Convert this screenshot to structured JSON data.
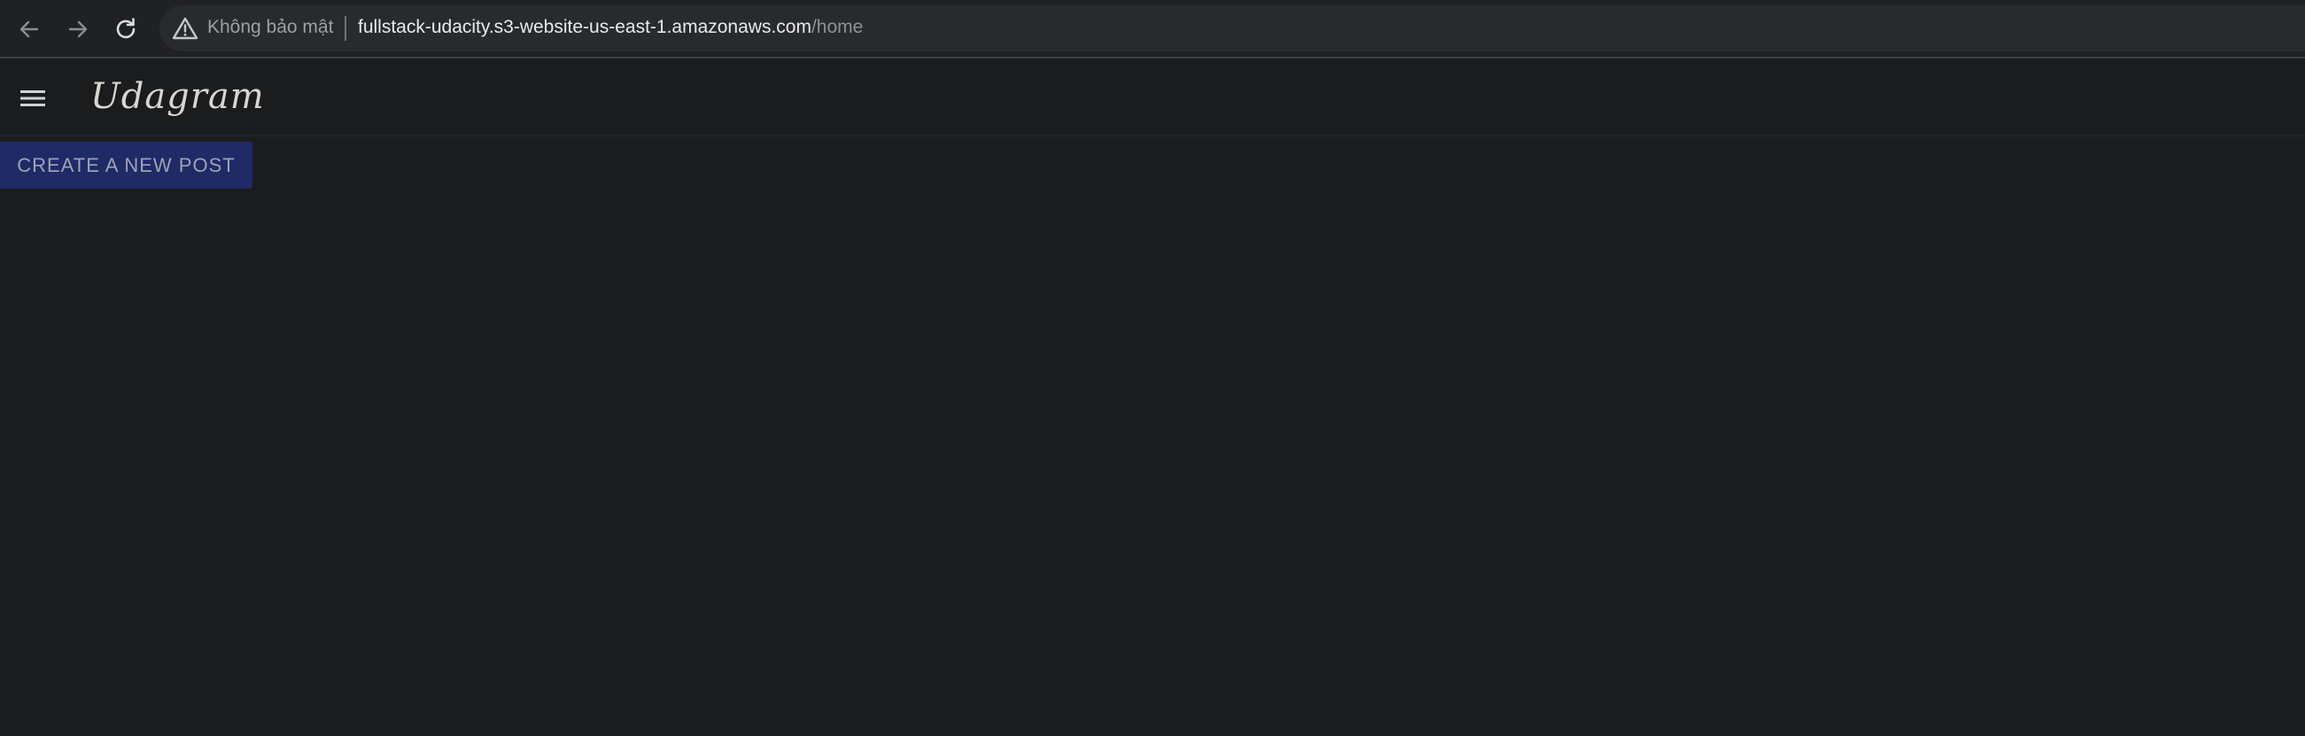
{
  "browser": {
    "back_icon": "arrow-left-icon",
    "forward_icon": "arrow-right-icon",
    "reload_icon": "reload-icon",
    "security_icon": "warning-triangle-icon",
    "security_label": "Không bảo mật",
    "url_host": "fullstack-udacity.s3-website-us-east-1.amazonaws.com",
    "url_path": "/home"
  },
  "app": {
    "menu_icon": "hamburger-menu-icon",
    "brand": "Udagram",
    "create_post_label": "CREATE A NEW POST"
  },
  "colors": {
    "page_background": "#1b1c1e",
    "button_background": "#1f2a66",
    "button_text": "#9ea3b8"
  }
}
